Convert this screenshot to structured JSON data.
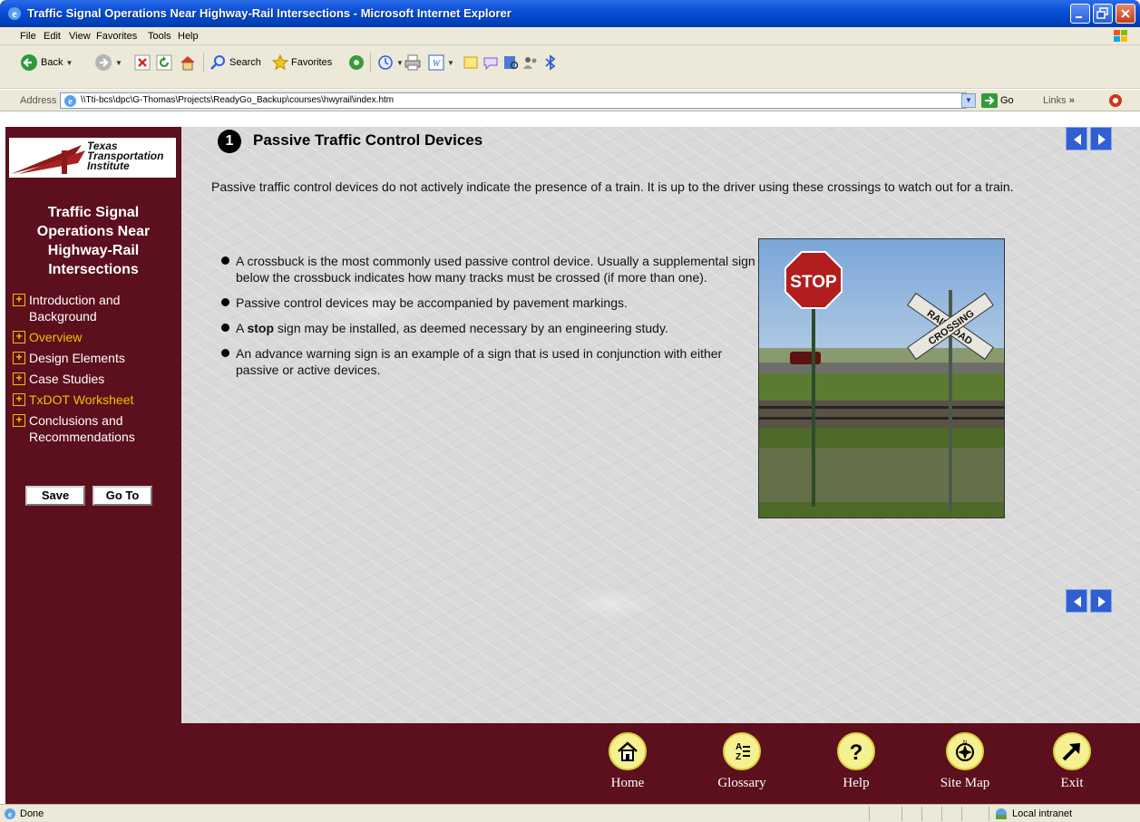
{
  "window": {
    "title": "Traffic Signal Operations Near Highway-Rail Intersections - Microsoft Internet Explorer"
  },
  "menu": [
    "File",
    "Edit",
    "View",
    "Favorites",
    "Tools",
    "Help"
  ],
  "toolbar": {
    "back": "Back",
    "search": "Search",
    "favorites": "Favorites"
  },
  "address": {
    "label": "Address",
    "url": "\\\\Tti-bcs\\dpc\\G-Thomas\\Projects\\ReadyGo_Backup\\courses\\hwyrail\\index.htm",
    "go": "Go",
    "links": "Links"
  },
  "sidebar": {
    "logo_text": "Texas\nTransportation\nInstitute",
    "course_title": "Traffic Signal Operations Near Highway-Rail Intersections",
    "items": [
      {
        "label": "Introduction and Background"
      },
      {
        "label": "Overview"
      },
      {
        "label": "Design Elements"
      },
      {
        "label": "Case Studies"
      },
      {
        "label": "TxDOT Worksheet"
      },
      {
        "label": "Conclusions and Recommendations"
      }
    ],
    "save": "Save",
    "goto": "Go To"
  },
  "content": {
    "step": "1",
    "title": "Passive Traffic Control Devices",
    "intro": "Passive traffic control devices do not actively indicate the presence of a train. It is up to the driver using these crossings to watch out for a train.",
    "bullets": [
      {
        "text": "A crossbuck is the most commonly used passive control device. Usually a supplemental sign below the crossbuck indicates how many tracks must be crossed (if more than one)."
      },
      {
        "text": "Passive control devices may be accompanied by pavement markings."
      },
      {
        "pre": "A ",
        "bold": "stop",
        "post": " sign may be installed, as deemed necessary by an engineering study."
      },
      {
        "text": "An advance warning sign is an example of a sign that is used in conjunction with either passive or active devices."
      }
    ],
    "photo": {
      "stop_sign": "STOP",
      "crossbuck_1": "RAILROAD",
      "crossbuck_2": "CROSSING"
    }
  },
  "footer": {
    "home": "Home",
    "glossary": "Glossary",
    "help": "Help",
    "sitemap": "Site Map",
    "exit": "Exit"
  },
  "status": {
    "left": "Done",
    "right": "Local intranet"
  },
  "colors": {
    "maroon": "#5c0f1c",
    "gold": "#f2c200",
    "xp_blue": "#0047c8"
  }
}
